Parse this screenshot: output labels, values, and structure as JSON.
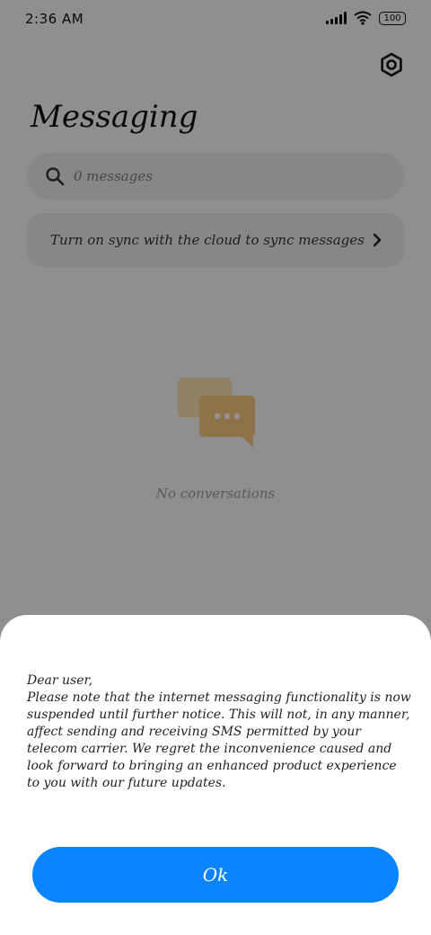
{
  "status_bar": {
    "time": "2:36 AM",
    "battery": "100"
  },
  "header": {
    "title": "Messaging",
    "settings_icon": "settings-gear-icon"
  },
  "search": {
    "placeholder": "0 messages"
  },
  "sync_banner": {
    "text": "Turn on sync with the cloud to sync messages"
  },
  "empty_state": {
    "text": "No conversations"
  },
  "dialog": {
    "greeting": "Dear user,",
    "body": "Please note that the internet messaging functionality is now suspended until further notice. This will not, in any manner, affect sending and receiving SMS permitted by your telecom carrier. We regret the inconvenience caused and look forward to bringing an enhanced product experience to you with our future updates.",
    "ok_label": "Ok"
  },
  "colors": {
    "accent": "#0d84ff",
    "overlay": "rgba(0,0,0,0.42)",
    "illustration": "#f5c77e"
  }
}
